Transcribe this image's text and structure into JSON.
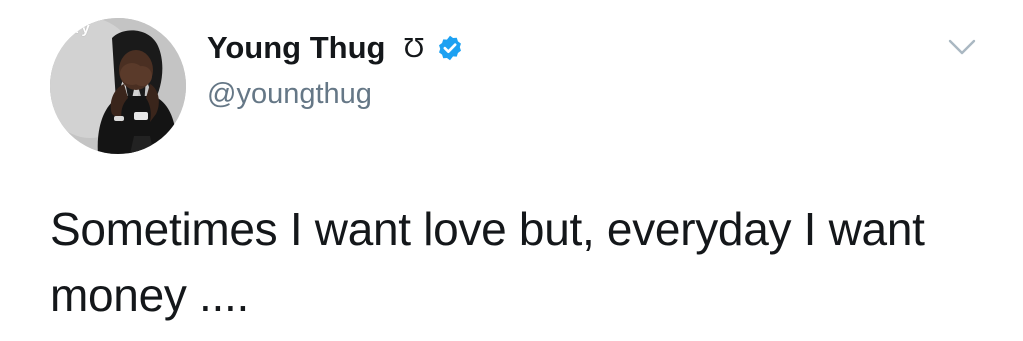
{
  "avatar": {
    "watermark_text": "ifery",
    "icon": "user-photo"
  },
  "author": {
    "display_name": "Young Thug",
    "name_glyph": "Ʊ",
    "handle": "@youngthug",
    "verified": true,
    "verified_color": "#1da1f2"
  },
  "menu": {
    "icon": "chevron-down-icon"
  },
  "tweet": {
    "text": "Sometimes I want love but, everyday I want money ...."
  },
  "colors": {
    "text": "#14171a",
    "secondary": "#657786",
    "chevron": "#aab8c2"
  }
}
